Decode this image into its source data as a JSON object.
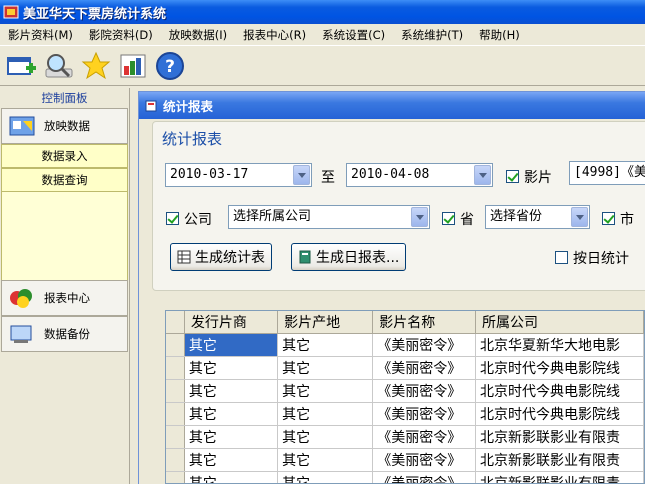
{
  "window": {
    "title": "美亚华天下票房统计系统"
  },
  "menu": [
    "影片资料(M)",
    "影院资料(D)",
    "放映数据(I)",
    "报表中心(R)",
    "系统设置(C)",
    "系统维护(T)",
    "帮助(H)"
  ],
  "left_panel": {
    "header": "控制面板",
    "nav_screening": "放映数据",
    "sub_items": [
      "数据录入",
      "数据查询"
    ],
    "nav_reports": "报表中心",
    "nav_backup": "数据备份"
  },
  "inner_window": {
    "title": "统计报表"
  },
  "form": {
    "group_title": "统计报表",
    "date_from": "2010-03-17",
    "to_label": "至",
    "date_to": "2010-04-08",
    "film_label": "影片",
    "film_value": "[4998]《美",
    "company_label": "公司",
    "company_value": "选择所属公司",
    "province_label": "省",
    "province_value": "选择省份",
    "city_label": "市",
    "btn_generate": "生成统计表",
    "btn_daily": "生成日报表...",
    "daily_stat_label": "按日统计"
  },
  "grid": {
    "columns": [
      "发行片商",
      "影片产地",
      "影片名称",
      "所属公司"
    ],
    "rows": [
      [
        "其它",
        "其它",
        "《美丽密令》",
        "北京华夏新华大地电影"
      ],
      [
        "其它",
        "其它",
        "《美丽密令》",
        "北京时代今典电影院线"
      ],
      [
        "其它",
        "其它",
        "《美丽密令》",
        "北京时代今典电影院线"
      ],
      [
        "其它",
        "其它",
        "《美丽密令》",
        "北京时代今典电影院线"
      ],
      [
        "其它",
        "其它",
        "《美丽密令》",
        "北京新影联影业有限责"
      ],
      [
        "其它",
        "其它",
        "《美丽密令》",
        "北京新影联影业有限责"
      ],
      [
        "其它",
        "其它",
        "《美丽密令》",
        "北京新影联影业有限责"
      ]
    ]
  },
  "colors": {
    "titlebar": "#0054e3",
    "selection": "#316ac5",
    "accent_text": "#1c4fa8"
  }
}
